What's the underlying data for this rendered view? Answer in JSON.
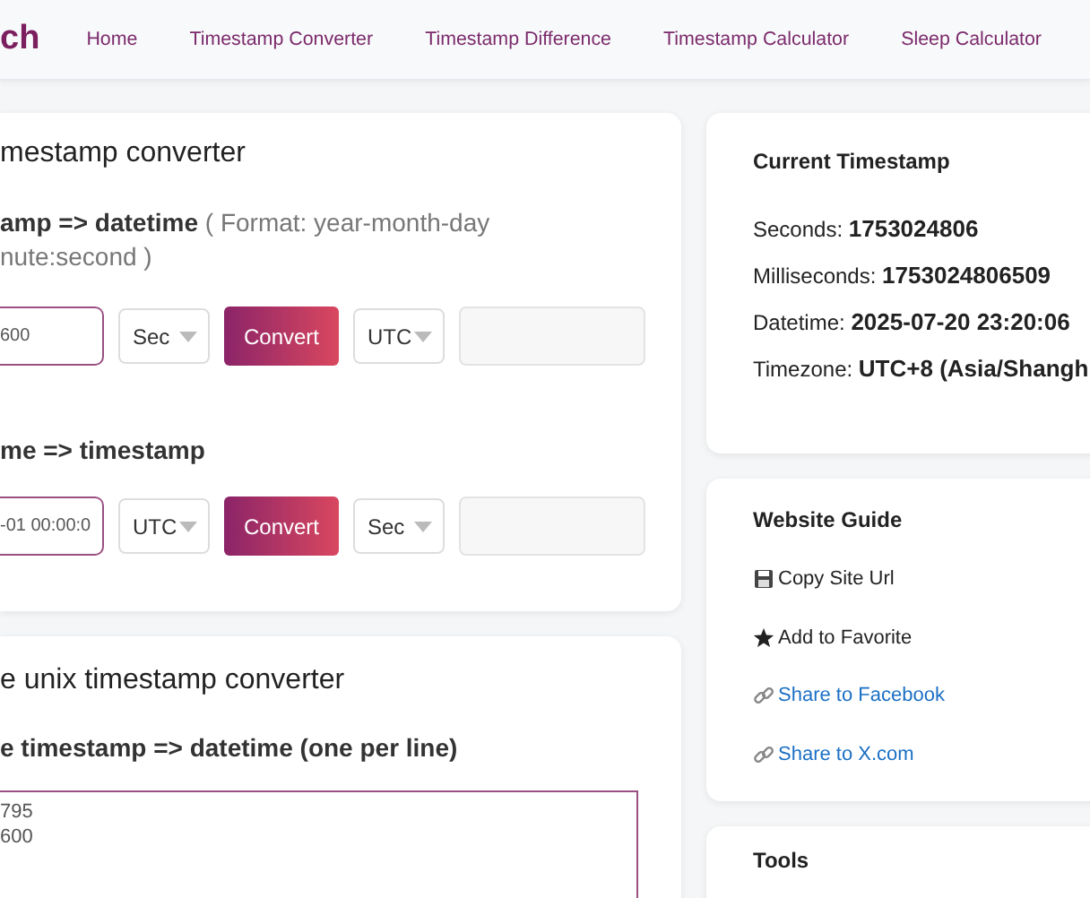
{
  "header": {
    "logo": "ch",
    "nav": [
      "Home",
      "Timestamp Converter",
      "Timestamp Difference",
      "Timestamp Calculator",
      "Sleep Calculator"
    ]
  },
  "converter": {
    "title": "mestamp converter",
    "sections": [
      {
        "label_bold": "amp => datetime",
        "label_note": "( Format: year-month-day",
        "label_note_2": "nute:second )",
        "input": "600",
        "select_1": "Sec",
        "button": "Convert",
        "select_2": "UTC"
      },
      {
        "label_bold": "me => timestamp",
        "input": "-01 00:00:0",
        "select_1": "UTC",
        "button": "Convert",
        "select_2": "Sec"
      }
    ]
  },
  "batch": {
    "title": "e unix timestamp converter",
    "label": "e timestamp => datetime (one per line)",
    "lines": [
      "795",
      "600"
    ]
  },
  "current": {
    "title": "Current Timestamp",
    "rows": [
      {
        "label": "Seconds:",
        "value": "1753024806"
      },
      {
        "label": "Milliseconds:",
        "value": "1753024806509"
      },
      {
        "label": "Datetime:",
        "value": "2025-07-20 23:20:06"
      },
      {
        "label": "Timezone:",
        "value": "UTC+8 (Asia/Shangh"
      }
    ]
  },
  "guide": {
    "title": "Website Guide",
    "items": [
      {
        "kind": "copy",
        "label": "Copy Site Url"
      },
      {
        "kind": "favorite",
        "label": "Add to Favorite"
      },
      {
        "kind": "share",
        "label": "Share to Facebook"
      },
      {
        "kind": "share",
        "label": "Share to X.com"
      }
    ]
  },
  "tools": {
    "title": "Tools"
  }
}
